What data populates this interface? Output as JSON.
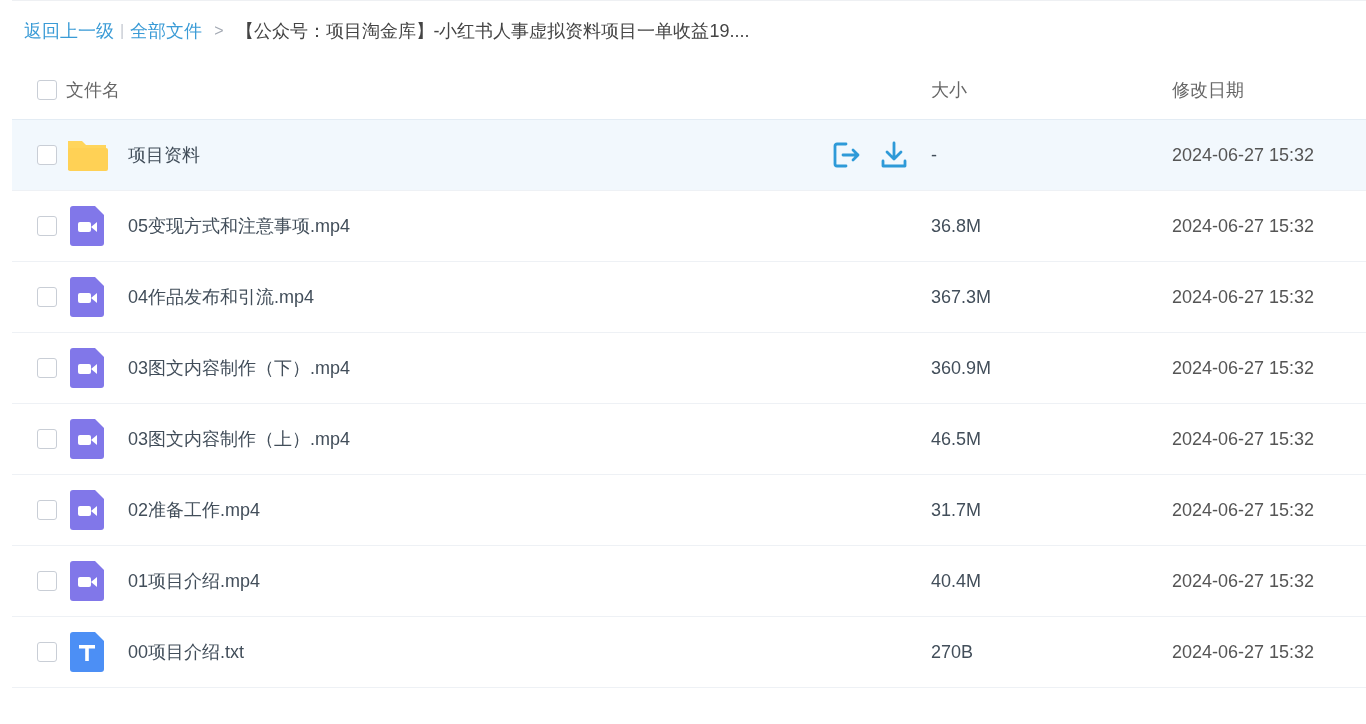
{
  "breadcrumb": {
    "back_link": "返回上一级",
    "divider": "|",
    "root_link": "全部文件",
    "arrow": ">",
    "current": "【公众号：项目淘金库】-小红书人事虚拟资料项目一单收益19...."
  },
  "table": {
    "header": {
      "checked": false,
      "columns": [
        "文件名",
        "大小",
        "修改日期"
      ]
    },
    "rows": [
      {
        "kind": "folder",
        "name": "项目资料",
        "size": "-",
        "date": "2024-06-27 15:32",
        "checked": false,
        "hovered": true
      },
      {
        "kind": "video",
        "name": "05变现方式和注意事项.mp4",
        "size": "36.8M",
        "date": "2024-06-27 15:32",
        "checked": false,
        "hovered": false
      },
      {
        "kind": "video",
        "name": "04作品发布和引流.mp4",
        "size": "367.3M",
        "date": "2024-06-27 15:32",
        "checked": false,
        "hovered": false
      },
      {
        "kind": "video",
        "name": "03图文内容制作（下）.mp4",
        "size": "360.9M",
        "date": "2024-06-27 15:32",
        "checked": false,
        "hovered": false
      },
      {
        "kind": "video",
        "name": "03图文内容制作（上）.mp4",
        "size": "46.5M",
        "date": "2024-06-27 15:32",
        "checked": false,
        "hovered": false
      },
      {
        "kind": "video",
        "name": "02准备工作.mp4",
        "size": "31.7M",
        "date": "2024-06-27 15:32",
        "checked": false,
        "hovered": false
      },
      {
        "kind": "video",
        "name": "01项目介绍.mp4",
        "size": "40.4M",
        "date": "2024-06-27 15:32",
        "checked": false,
        "hovered": false
      },
      {
        "kind": "text",
        "name": "00项目介绍.txt",
        "size": "270B",
        "date": "2024-06-27 15:32",
        "checked": false,
        "hovered": false
      }
    ]
  }
}
